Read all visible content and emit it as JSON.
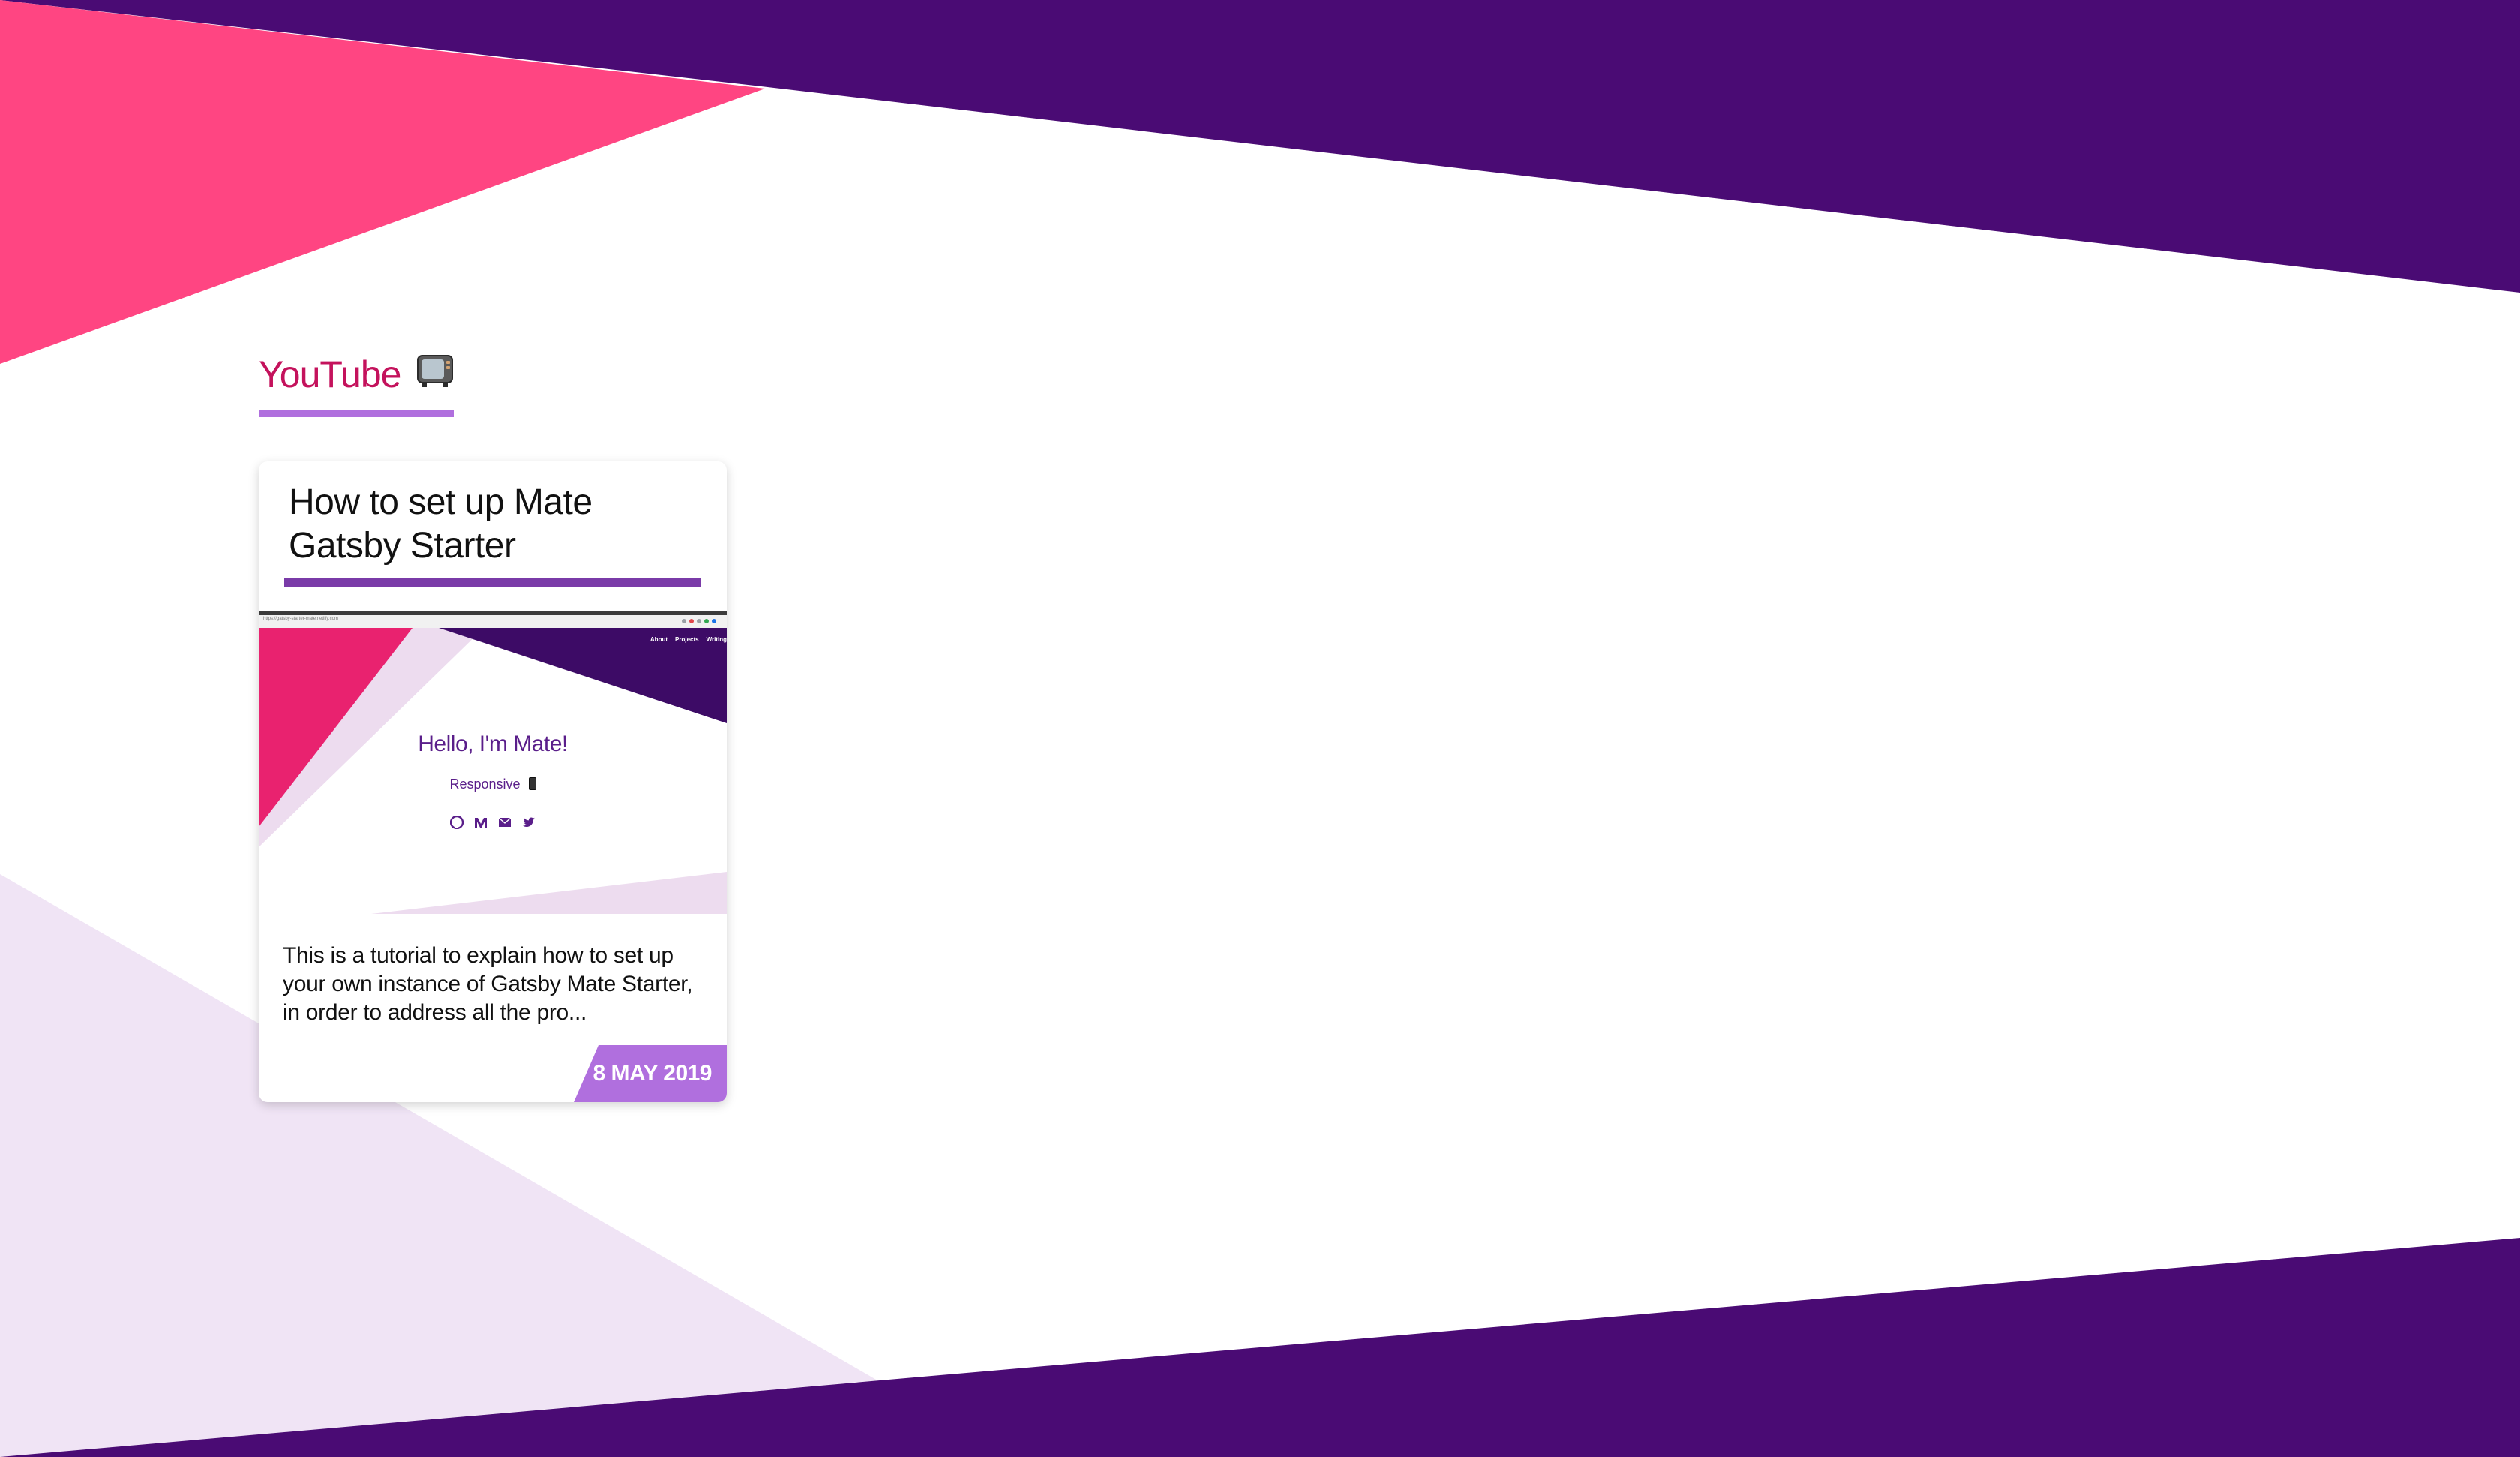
{
  "colors": {
    "accent_pink": "#ff4582",
    "dark_purple": "#4a0b74",
    "light_lavender": "#f0e4f5",
    "heading_color": "#c4125c",
    "underline_color": "#b06fde",
    "card_title_underline": "#7a3ba8",
    "date_badge_bg": "#b06fde"
  },
  "section": {
    "heading": "YouTube",
    "icon": "television-icon"
  },
  "card": {
    "title": "How to set up Mate Gatsby Starter",
    "description": "This is a tutorial to explain how to set up your own instance of Gatsby Mate Starter, in order to address all the pro...",
    "date": "8 MAY 2019",
    "thumbnail": {
      "url_text": "https://gatsby-starter-mate.netlify.com",
      "nav_items": [
        "About",
        "Projects",
        "Writing"
      ],
      "greeting": "Hello, I'm Mate!",
      "tagline": "Responsive",
      "tagline_icon": "mobile-phone-icon",
      "social_icons": [
        "github-icon",
        "medium-icon",
        "email-icon",
        "twitter-icon"
      ]
    }
  }
}
